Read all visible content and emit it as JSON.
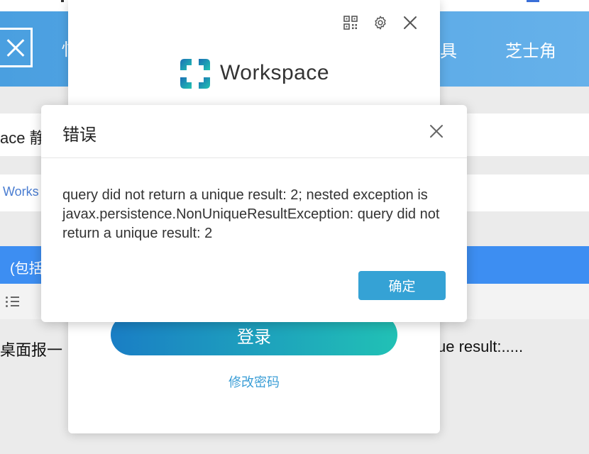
{
  "background_page": {
    "nav_partial": "忄",
    "nav_tools_partial": "具",
    "nav_cheese": "芝士角",
    "row1_text": "ace 静",
    "row2_link": "Works",
    "blue_bar_text": "(包括",
    "text_left": "桌面报一",
    "text_right": "ue result:....."
  },
  "login_panel": {
    "brand_name": "Workspace",
    "login_button": "登录",
    "change_password_link": "修改密码",
    "icons": [
      "qr-code-icon",
      "gear-icon",
      "close-icon"
    ]
  },
  "error_dialog": {
    "title": "错误",
    "message": "query did not return a unique result: 2; nested exception is javax.persistence.NonUniqueResultException: query did not return a unique result: 2",
    "ok_button": "确定",
    "accent_color": "#35a2d5"
  },
  "colors": {
    "header_blue": "#4a9fe0",
    "blue_bar": "#3d8ef2",
    "login_gradient_start": "#1a7ec5",
    "login_gradient_end": "#21c1b5"
  }
}
